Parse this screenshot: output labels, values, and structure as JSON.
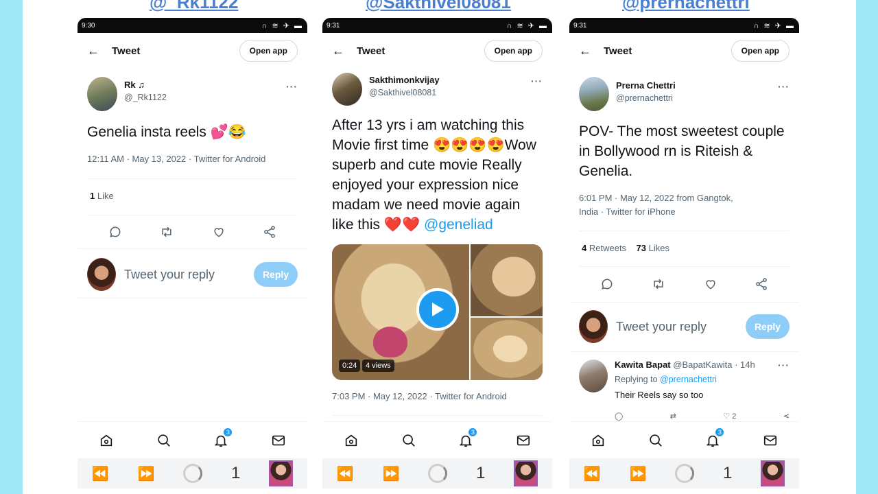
{
  "headers": [
    "@_Rk1122",
    "@Sakthivel08081",
    "@prernachettri"
  ],
  "colors": {
    "accent": "#1d9bf0",
    "reply_disabled": "#8ecdf8",
    "heart": "#e0245e"
  },
  "phones": [
    {
      "time": "9:30",
      "topbar": {
        "title": "Tweet",
        "open_app": "Open app"
      },
      "author": {
        "name": "Rk",
        "music_note": "♫",
        "handle": "@_Rk1122"
      },
      "body": "Genelia insta reels 💕😂",
      "meta": "12:11 AM · May 13, 2022 · Twitter for Android",
      "stats": {
        "likes_count": "1",
        "likes_label": "Like"
      },
      "reply": {
        "placeholder": "Tweet your reply",
        "button": "Reply"
      },
      "nav_badge": "3",
      "sys_num": "1"
    },
    {
      "time": "9:31",
      "topbar": {
        "title": "Tweet",
        "open_app": "Open app"
      },
      "author": {
        "name": "Sakthimonkvijay",
        "handle": "@Sakthivel08081"
      },
      "body_text": "After 13 yrs i am watching this Movie first time 😍😍😍😍Wow superb and cute movie Really enjoyed your expression nice madam we need movie again like this ❤️❤️ ",
      "body_mention": "@geneliad",
      "video": {
        "duration": "0:24",
        "views": "4 views"
      },
      "meta": "7:03 PM · May 12, 2022 · Twitter for Android",
      "nav_badge": "3",
      "sys_num": "1"
    },
    {
      "time": "9:31",
      "topbar": {
        "title": "Tweet",
        "open_app": "Open app"
      },
      "author": {
        "name": "Prerna Chettri",
        "handle": "@prernachettri"
      },
      "body": "POV- The most sweetest couple in Bollywood rn is Riteish & Genelia.",
      "meta_line1": "6:01 PM · May 12, 2022 from Gangtok,",
      "meta_line2": "India · Twitter for iPhone",
      "stats": {
        "retweets_count": "4",
        "retweets_label": "Retweets",
        "likes_count": "73",
        "likes_label": "Likes"
      },
      "reply": {
        "placeholder": "Tweet your reply",
        "button": "Reply"
      },
      "comment": {
        "name": "Kawita Bapat",
        "handle_time": "@BapatKawita · 14h",
        "replying_prefix": "Replying to",
        "replying_to": "@prernachettri",
        "text": "Their Reels say so too",
        "likes": "2"
      },
      "nav_badge": "3",
      "sys_num": "1"
    }
  ]
}
